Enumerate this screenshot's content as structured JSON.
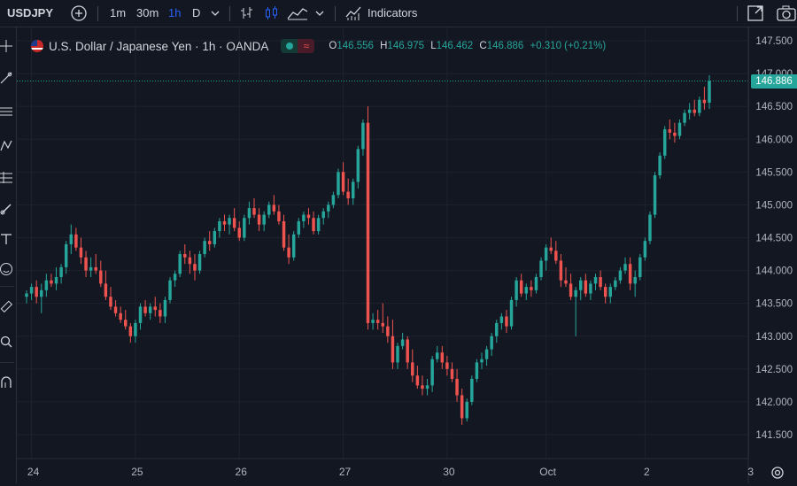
{
  "toolbar": {
    "symbol": "USDJPY",
    "intervals": [
      "1m",
      "30m",
      "1h",
      "D"
    ],
    "active_interval": "1h",
    "indicators_label": "Indicators",
    "icons": [
      "add-symbol-icon",
      "chevron-down-icon",
      "bar-style-icon",
      "candle-style-icon",
      "area-style-icon",
      "chevron-down-icon",
      "indicators-icon",
      "snapshot-icon",
      "camera-icon"
    ]
  },
  "left_toolbar": {
    "icons": [
      "crosshair-icon",
      "trend-line-icon",
      "fib-icon",
      "pattern-icon",
      "projection-icon",
      "brush-icon",
      "text-icon",
      "emoji-icon",
      "ruler-icon",
      "zoom-icon",
      "magnet-icon"
    ]
  },
  "legend": {
    "title": "U.S. Dollar / Japanese Yen · 1h · OANDA",
    "open_key": "O",
    "open": "146.556",
    "high_key": "H",
    "high": "146.975",
    "low_key": "L",
    "low": "146.462",
    "close_key": "C",
    "close": "146.886",
    "change": "+0.310 (+0.21%)"
  },
  "colors": {
    "up": "#26a69a",
    "down": "#ef5350",
    "background": "#131722",
    "grid": "#1e222d"
  },
  "last_price": "146.886",
  "chart_data": {
    "type": "candlestick",
    "ylim": [
      141.3,
      147.6
    ],
    "y_ticks": [
      "147.500",
      "147.000",
      "146.500",
      "146.000",
      "145.500",
      "145.000",
      "144.500",
      "144.000",
      "143.500",
      "143.000",
      "142.500",
      "142.000",
      "141.500"
    ],
    "y_tick_values": [
      147.5,
      147.0,
      146.5,
      146.0,
      145.5,
      145.0,
      144.5,
      144.0,
      143.5,
      143.0,
      142.5,
      142.0,
      141.5
    ],
    "x_ticks": [
      "24",
      "25",
      "26",
      "27",
      "30",
      "Oct",
      "2",
      "3"
    ],
    "x_tick_index": [
      1,
      22,
      43,
      64,
      85,
      105,
      125,
      146
    ],
    "grid": true,
    "candles": [
      [
        143.6,
        143.7,
        143.5,
        143.65
      ],
      [
        143.65,
        143.8,
        143.55,
        143.75
      ],
      [
        143.75,
        143.85,
        143.5,
        143.6
      ],
      [
        143.6,
        143.8,
        143.35,
        143.7
      ],
      [
        143.7,
        143.95,
        143.6,
        143.85
      ],
      [
        143.85,
        143.95,
        143.75,
        143.8
      ],
      [
        143.8,
        144.05,
        143.7,
        143.9
      ],
      [
        143.9,
        144.1,
        143.8,
        144.05
      ],
      [
        144.05,
        144.45,
        143.95,
        144.4
      ],
      [
        144.4,
        144.7,
        144.25,
        144.55
      ],
      [
        144.55,
        144.65,
        144.3,
        144.35
      ],
      [
        144.35,
        144.5,
        144.1,
        144.2
      ],
      [
        144.2,
        144.3,
        143.9,
        144.0
      ],
      [
        144.0,
        144.2,
        143.9,
        144.05
      ],
      [
        144.05,
        144.25,
        143.95,
        144.0
      ],
      [
        144.0,
        144.15,
        143.75,
        143.8
      ],
      [
        143.8,
        144.0,
        143.55,
        143.6
      ],
      [
        143.6,
        143.75,
        143.4,
        143.45
      ],
      [
        143.45,
        143.55,
        143.3,
        143.35
      ],
      [
        143.35,
        143.45,
        143.2,
        143.25
      ],
      [
        143.25,
        143.4,
        143.1,
        143.15
      ],
      [
        143.15,
        143.2,
        142.9,
        143.0
      ],
      [
        143.0,
        143.25,
        142.9,
        143.2
      ],
      [
        143.2,
        143.5,
        143.1,
        143.45
      ],
      [
        143.45,
        143.55,
        143.3,
        143.35
      ],
      [
        143.35,
        143.5,
        143.25,
        143.45
      ],
      [
        143.45,
        143.6,
        143.3,
        143.4
      ],
      [
        143.4,
        143.5,
        143.2,
        143.3
      ],
      [
        143.3,
        143.6,
        143.2,
        143.55
      ],
      [
        143.55,
        143.9,
        143.5,
        143.85
      ],
      [
        143.85,
        144.0,
        143.75,
        143.95
      ],
      [
        143.95,
        144.3,
        143.9,
        144.25
      ],
      [
        144.25,
        144.4,
        144.1,
        144.2
      ],
      [
        144.2,
        144.3,
        143.95,
        144.1
      ],
      [
        144.1,
        144.25,
        143.85,
        144.0
      ],
      [
        144.0,
        144.3,
        143.95,
        144.25
      ],
      [
        144.25,
        144.5,
        144.2,
        144.45
      ],
      [
        144.45,
        144.6,
        144.3,
        144.4
      ],
      [
        144.4,
        144.65,
        144.35,
        144.6
      ],
      [
        144.6,
        144.8,
        144.5,
        144.75
      ],
      [
        144.75,
        144.85,
        144.6,
        144.7
      ],
      [
        144.7,
        144.85,
        144.55,
        144.8
      ],
      [
        144.8,
        144.95,
        144.6,
        144.65
      ],
      [
        144.65,
        144.75,
        144.45,
        144.5
      ],
      [
        144.5,
        144.85,
        144.45,
        144.8
      ],
      [
        144.8,
        145.05,
        144.7,
        144.95
      ],
      [
        144.95,
        145.1,
        144.8,
        144.85
      ],
      [
        144.85,
        144.95,
        144.6,
        144.7
      ],
      [
        144.7,
        144.9,
        144.6,
        144.85
      ],
      [
        144.85,
        145.05,
        144.8,
        145.0
      ],
      [
        145.0,
        145.15,
        144.85,
        144.9
      ],
      [
        144.9,
        145.0,
        144.7,
        144.75
      ],
      [
        144.75,
        144.85,
        144.3,
        144.35
      ],
      [
        144.35,
        144.55,
        144.1,
        144.2
      ],
      [
        144.2,
        144.6,
        144.15,
        144.55
      ],
      [
        144.55,
        144.8,
        144.5,
        144.75
      ],
      [
        144.75,
        144.9,
        144.65,
        144.85
      ],
      [
        144.85,
        144.95,
        144.7,
        144.8
      ],
      [
        144.8,
        144.9,
        144.55,
        144.6
      ],
      [
        144.6,
        144.85,
        144.55,
        144.8
      ],
      [
        144.8,
        144.95,
        144.7,
        144.9
      ],
      [
        144.9,
        145.05,
        144.8,
        145.0
      ],
      [
        145.0,
        145.2,
        144.95,
        145.15
      ],
      [
        145.15,
        145.55,
        145.1,
        145.5
      ],
      [
        145.5,
        145.65,
        145.15,
        145.2
      ],
      [
        145.2,
        145.4,
        145.0,
        145.1
      ],
      [
        145.1,
        145.4,
        145.0,
        145.35
      ],
      [
        145.35,
        145.9,
        145.25,
        145.85
      ],
      [
        145.85,
        146.3,
        145.75,
        146.25
      ],
      [
        146.25,
        146.5,
        143.1,
        143.2
      ],
      [
        143.2,
        143.35,
        143.1,
        143.25
      ],
      [
        143.25,
        143.4,
        143.1,
        143.2
      ],
      [
        143.2,
        143.5,
        143.05,
        143.15
      ],
      [
        143.15,
        143.3,
        142.9,
        143.0
      ],
      [
        143.0,
        143.25,
        142.5,
        142.6
      ],
      [
        142.6,
        142.9,
        142.5,
        142.85
      ],
      [
        142.85,
        143.05,
        142.8,
        142.95
      ],
      [
        142.95,
        143.0,
        142.5,
        142.6
      ],
      [
        142.6,
        142.8,
        142.3,
        142.4
      ],
      [
        142.4,
        142.55,
        142.2,
        142.25
      ],
      [
        142.25,
        142.4,
        142.1,
        142.2
      ],
      [
        142.2,
        142.35,
        142.1,
        142.25
      ],
      [
        142.25,
        142.7,
        142.15,
        142.65
      ],
      [
        142.65,
        142.85,
        142.6,
        142.75
      ],
      [
        142.75,
        142.85,
        142.5,
        142.6
      ],
      [
        142.6,
        142.7,
        142.4,
        142.5
      ],
      [
        142.5,
        142.6,
        142.3,
        142.35
      ],
      [
        142.35,
        142.5,
        142.0,
        142.1
      ],
      [
        142.1,
        142.2,
        141.65,
        141.75
      ],
      [
        141.75,
        142.05,
        141.7,
        142.0
      ],
      [
        142.0,
        142.4,
        141.95,
        142.35
      ],
      [
        142.35,
        142.65,
        142.3,
        142.6
      ],
      [
        142.6,
        142.75,
        142.5,
        142.65
      ],
      [
        142.65,
        142.85,
        142.55,
        142.8
      ],
      [
        142.8,
        143.05,
        142.7,
        143.0
      ],
      [
        143.0,
        143.25,
        142.9,
        143.2
      ],
      [
        143.2,
        143.35,
        143.1,
        143.3
      ],
      [
        143.3,
        143.4,
        143.05,
        143.15
      ],
      [
        143.15,
        143.6,
        143.1,
        143.55
      ],
      [
        143.55,
        143.9,
        143.45,
        143.85
      ],
      [
        143.85,
        143.95,
        143.6,
        143.65
      ],
      [
        143.65,
        143.8,
        143.55,
        143.75
      ],
      [
        143.75,
        143.85,
        143.6,
        143.7
      ],
      [
        143.7,
        143.95,
        143.65,
        143.9
      ],
      [
        143.9,
        144.2,
        143.85,
        144.15
      ],
      [
        144.15,
        144.4,
        144.0,
        144.35
      ],
      [
        144.35,
        144.5,
        144.25,
        144.3
      ],
      [
        144.3,
        144.45,
        144.1,
        144.15
      ],
      [
        144.15,
        144.25,
        143.75,
        143.85
      ],
      [
        143.85,
        144.05,
        143.75,
        143.8
      ],
      [
        143.8,
        143.95,
        143.55,
        143.6
      ],
      [
        143.6,
        143.75,
        143.0,
        143.7
      ],
      [
        143.7,
        143.9,
        143.55,
        143.85
      ],
      [
        143.85,
        143.95,
        143.6,
        143.65
      ],
      [
        143.65,
        143.85,
        143.55,
        143.8
      ],
      [
        143.8,
        143.95,
        143.7,
        143.9
      ],
      [
        143.9,
        144.0,
        143.7,
        143.75
      ],
      [
        143.75,
        143.8,
        143.5,
        143.6
      ],
      [
        143.6,
        143.8,
        143.5,
        143.75
      ],
      [
        143.75,
        143.9,
        143.7,
        143.85
      ],
      [
        143.85,
        144.05,
        143.8,
        144.0
      ],
      [
        144.0,
        144.2,
        143.95,
        144.1
      ],
      [
        144.1,
        144.2,
        143.7,
        143.8
      ],
      [
        143.8,
        144.0,
        143.6,
        143.9
      ],
      [
        143.9,
        144.25,
        143.85,
        144.2
      ],
      [
        144.2,
        144.5,
        144.15,
        144.45
      ],
      [
        144.45,
        144.9,
        144.4,
        144.85
      ],
      [
        144.85,
        145.5,
        144.8,
        145.45
      ],
      [
        145.45,
        145.8,
        145.4,
        145.75
      ],
      [
        145.75,
        146.2,
        145.7,
        146.15
      ],
      [
        146.15,
        146.3,
        146.0,
        146.1
      ],
      [
        146.1,
        146.25,
        145.95,
        146.05
      ],
      [
        146.05,
        146.3,
        146.0,
        146.25
      ],
      [
        146.25,
        146.45,
        146.2,
        146.4
      ],
      [
        146.4,
        146.55,
        146.3,
        146.45
      ],
      [
        146.45,
        146.6,
        146.35,
        146.4
      ],
      [
        146.4,
        146.65,
        146.35,
        146.6
      ],
      [
        146.6,
        146.8,
        146.45,
        146.55
      ],
      [
        146.556,
        146.975,
        146.462,
        146.886
      ]
    ]
  }
}
